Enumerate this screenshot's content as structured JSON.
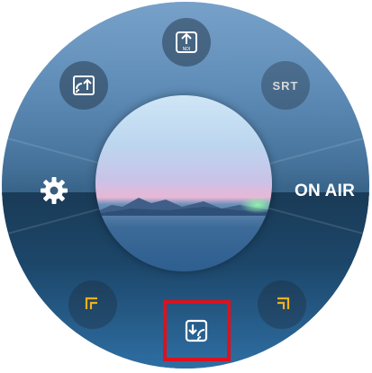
{
  "dial": {
    "buttons": {
      "ndi_upload": {
        "icon": "ndi-upload-icon",
        "caption": "NDI"
      },
      "cast_upload": {
        "icon": "cast-upload-icon"
      },
      "srt": {
        "icon": "srt-icon",
        "label": "SRT"
      },
      "settings": {
        "icon": "gear-icon"
      },
      "on_air": {
        "label": "ON AIR"
      },
      "corner_left": {
        "icon": "corner-bracket-left-icon"
      },
      "corner_right": {
        "icon": "corner-bracket-right-icon"
      },
      "cast_download": {
        "icon": "cast-download-icon",
        "highlighted": true
      }
    }
  },
  "colors": {
    "highlight_border": "#e0101c",
    "accent_bracket": "#f0b020",
    "icon_white": "#ffffff"
  }
}
